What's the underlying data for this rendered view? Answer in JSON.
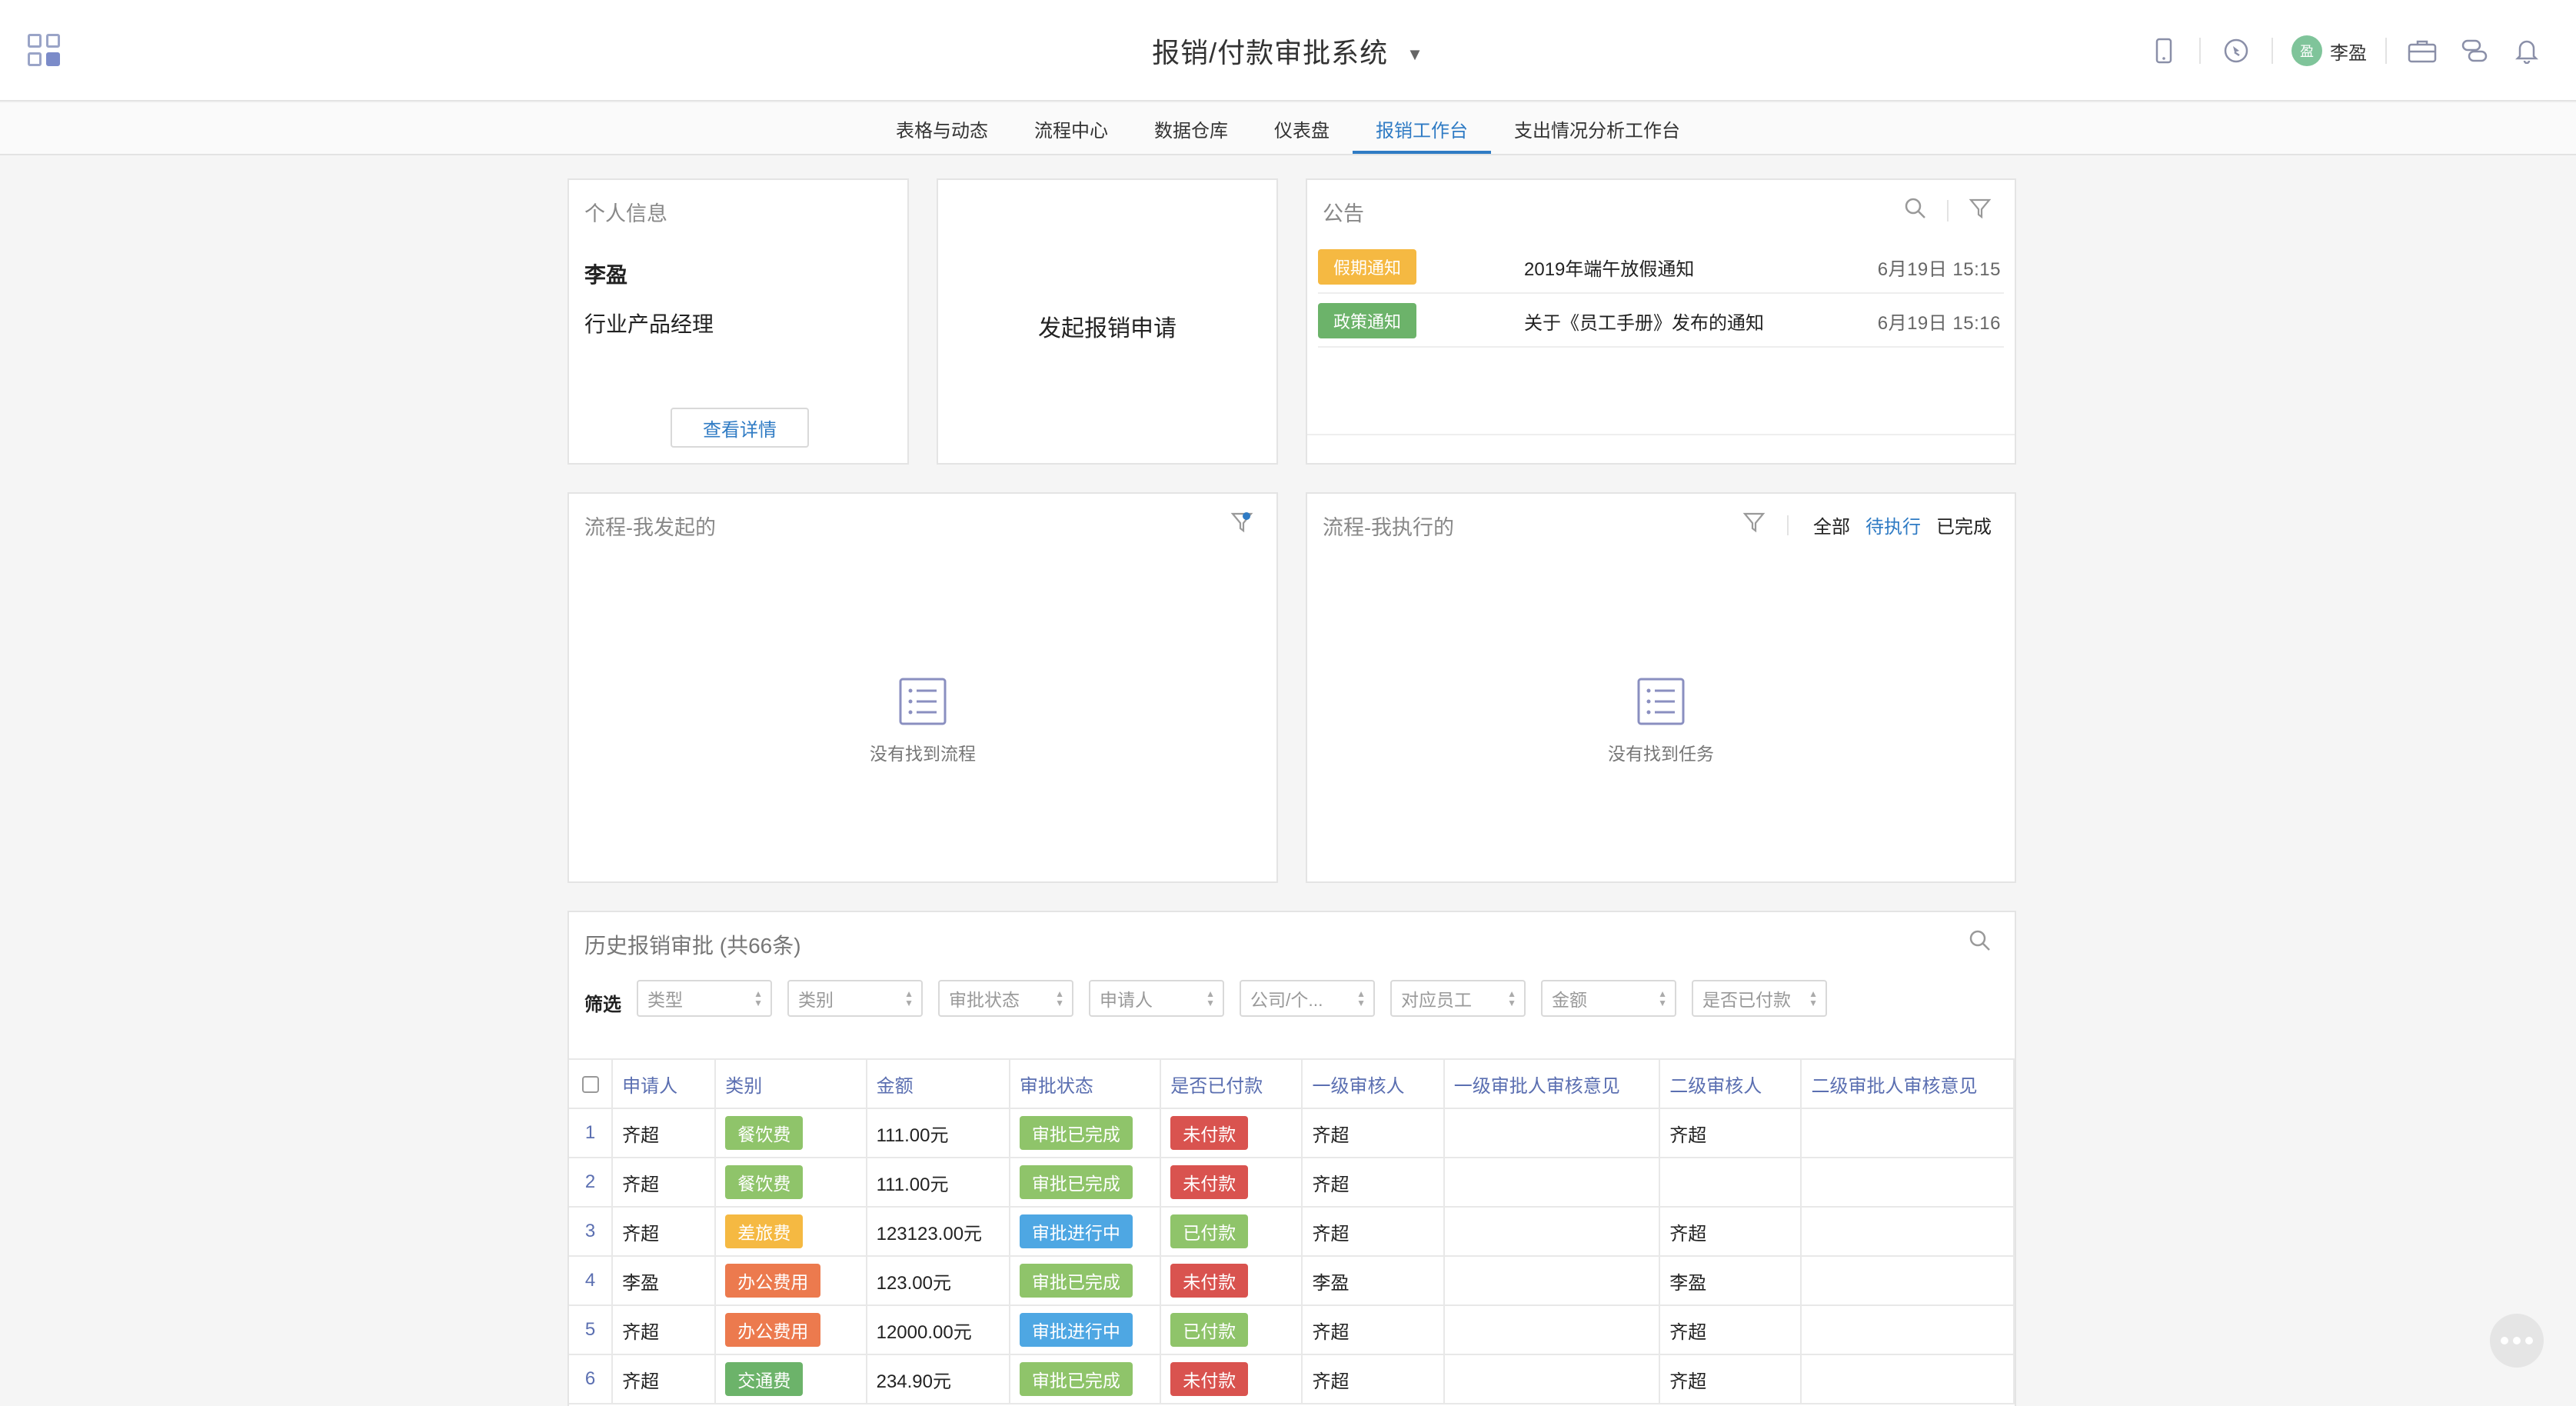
{
  "header": {
    "title": "报销/付款审批系统",
    "user_initial": "盈",
    "user_name": "李盈",
    "icons": [
      "apps-grid-icon",
      "mobile-icon",
      "compass-icon",
      "briefcase-icon",
      "link-icon",
      "bell-icon"
    ]
  },
  "nav": {
    "tabs": [
      "表格与动态",
      "流程中心",
      "数据仓库",
      "仪表盘",
      "报销工作台",
      "支出情况分析工作台"
    ],
    "active": "报销工作台"
  },
  "personal": {
    "title": "个人信息",
    "name": "李盈",
    "role": "行业产品经理",
    "details_button": "查看详情"
  },
  "launch": {
    "label": "发起报销申请"
  },
  "announcements": {
    "title": "公告",
    "items": [
      {
        "tag": "假期通知",
        "tag_color": "#f5b942",
        "text": "2019年端午放假通知",
        "date": "6月19日 15:15"
      },
      {
        "tag": "政策通知",
        "tag_color": "#6cb36a",
        "text": "关于《员工手册》发布的通知",
        "date": "6月19日 15:16"
      }
    ]
  },
  "my_started": {
    "title": "流程-我发起的",
    "empty": "没有找到流程"
  },
  "my_executed": {
    "title": "流程-我执行的",
    "empty": "没有找到任务",
    "tabs": [
      "全部",
      "待执行",
      "已完成"
    ],
    "active_tab": "待执行"
  },
  "history": {
    "title": "历史报销审批 (共66条)",
    "filter_label": "筛选",
    "filters": [
      "类型",
      "类别",
      "审批状态",
      "申请人",
      "公司/个...",
      "对应员工",
      "金额",
      "是否已付款"
    ],
    "columns": [
      "申请人",
      "类别",
      "金额",
      "审批状态",
      "是否已付款",
      "一级审核人",
      "一级审批人审核意见",
      "二级审核人",
      "二级审批人审核意见"
    ],
    "rows": [
      {
        "no": "1",
        "applicant": "齐超",
        "category": "餐饮费",
        "cat_color": "#8fc46a",
        "amount": "111.00元",
        "status": "审批已完成",
        "status_color": "#8fc46a",
        "paid": "未付款",
        "paid_color": "#d9534f",
        "reviewer1": "齐超",
        "opinion1": "",
        "reviewer2": "齐超",
        "opinion2": ""
      },
      {
        "no": "2",
        "applicant": "齐超",
        "category": "餐饮费",
        "cat_color": "#8fc46a",
        "amount": "111.00元",
        "status": "审批已完成",
        "status_color": "#8fc46a",
        "paid": "未付款",
        "paid_color": "#d9534f",
        "reviewer1": "齐超",
        "opinion1": "",
        "reviewer2": "",
        "opinion2": ""
      },
      {
        "no": "3",
        "applicant": "齐超",
        "category": "差旅费",
        "cat_color": "#f5b942",
        "amount": "123123.00元",
        "status": "审批进行中",
        "status_color": "#4ea7e3",
        "paid": "已付款",
        "paid_color": "#8fc46a",
        "reviewer1": "齐超",
        "opinion1": "",
        "reviewer2": "齐超",
        "opinion2": ""
      },
      {
        "no": "4",
        "applicant": "李盈",
        "category": "办公费用",
        "cat_color": "#ec7a4e",
        "amount": "123.00元",
        "status": "审批已完成",
        "status_color": "#8fc46a",
        "paid": "未付款",
        "paid_color": "#d9534f",
        "reviewer1": "李盈",
        "opinion1": "",
        "reviewer2": "李盈",
        "opinion2": ""
      },
      {
        "no": "5",
        "applicant": "齐超",
        "category": "办公费用",
        "cat_color": "#ec7a4e",
        "amount": "12000.00元",
        "status": "审批进行中",
        "status_color": "#4ea7e3",
        "paid": "已付款",
        "paid_color": "#8fc46a",
        "reviewer1": "齐超",
        "opinion1": "",
        "reviewer2": "齐超",
        "opinion2": ""
      },
      {
        "no": "6",
        "applicant": "齐超",
        "category": "交通费",
        "cat_color": "#6cb36a",
        "amount": "234.90元",
        "status": "审批已完成",
        "status_color": "#8fc46a",
        "paid": "未付款",
        "paid_color": "#d9534f",
        "reviewer1": "齐超",
        "opinion1": "",
        "reviewer2": "齐超",
        "opinion2": ""
      }
    ]
  }
}
